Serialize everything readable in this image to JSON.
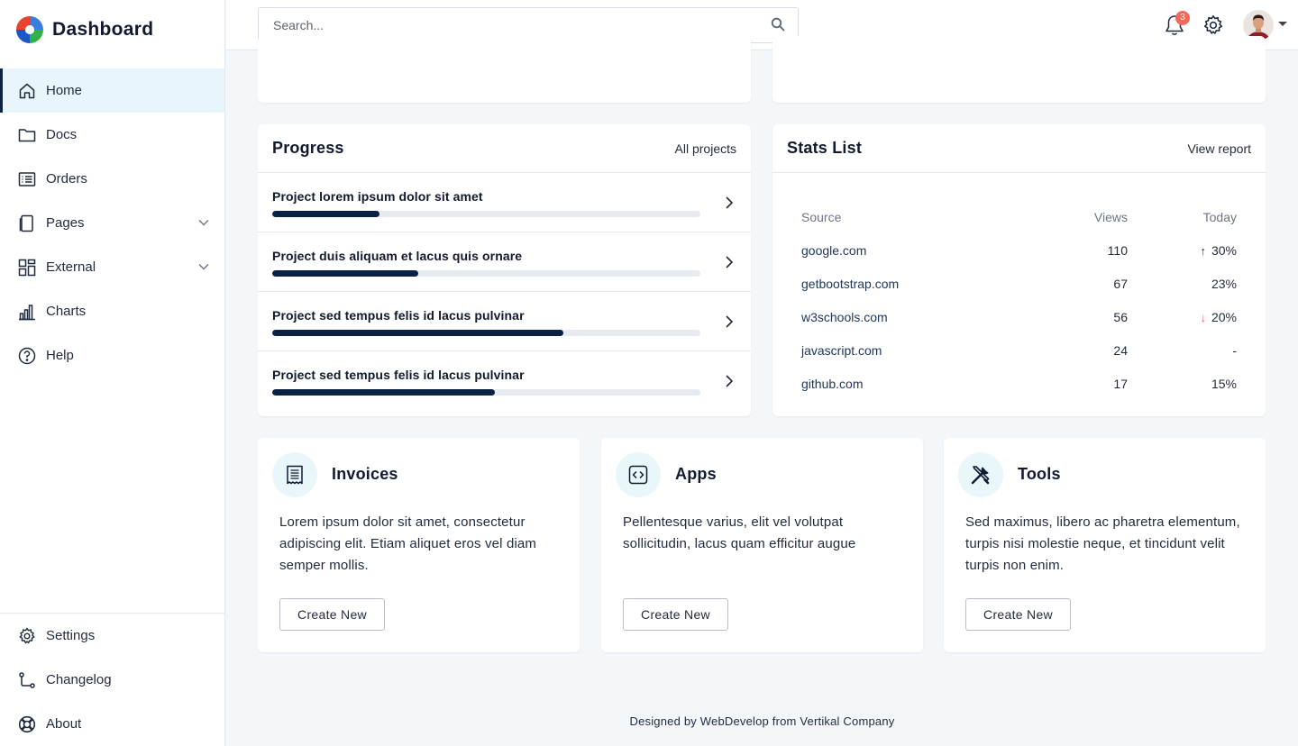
{
  "brand": {
    "title": "Dashboard"
  },
  "sidebar": {
    "items": [
      {
        "label": "Home",
        "icon": "home-icon",
        "active": true
      },
      {
        "label": "Docs",
        "icon": "folder-icon"
      },
      {
        "label": "Orders",
        "icon": "list-icon"
      },
      {
        "label": "Pages",
        "icon": "pages-icon",
        "expandable": true
      },
      {
        "label": "External",
        "icon": "grid-icon",
        "expandable": true
      },
      {
        "label": "Charts",
        "icon": "chart-icon"
      },
      {
        "label": "Help",
        "icon": "help-icon"
      }
    ],
    "bottom_items": [
      {
        "label": "Settings",
        "icon": "gear-icon"
      },
      {
        "label": "Changelog",
        "icon": "changelog-icon"
      },
      {
        "label": "About",
        "icon": "lifebuoy-icon"
      }
    ]
  },
  "topbar": {
    "search_placeholder": "Search...",
    "notification_count": "3",
    "accent": "#f16a5b"
  },
  "progress": {
    "title": "Progress",
    "link": "All projects",
    "projects": [
      {
        "name": "Project lorem ipsum dolor sit amet",
        "percent": 25
      },
      {
        "name": "Project duis aliquam et lacus quis ornare",
        "percent": 34
      },
      {
        "name": "Project sed tempus felis id lacus pulvinar",
        "percent": 68
      },
      {
        "name": "Project sed tempus felis id lacus pulvinar",
        "percent": 52
      }
    ]
  },
  "stats": {
    "title": "Stats List",
    "link": "View report",
    "headers": [
      "Source",
      "Views",
      "Today"
    ],
    "rows": [
      {
        "source": "google.com",
        "views": "110",
        "today": "30%",
        "trend": "up"
      },
      {
        "source": "getbootstrap.com",
        "views": "67",
        "today": "23%",
        "trend": ""
      },
      {
        "source": "w3schools.com",
        "views": "56",
        "today": "20%",
        "trend": "down"
      },
      {
        "source": "javascript.com",
        "views": "24",
        "today": "-",
        "trend": ""
      },
      {
        "source": "github.com",
        "views": "17",
        "today": "15%",
        "trend": ""
      }
    ]
  },
  "features": [
    {
      "title": "Invoices",
      "icon": "invoice-icon",
      "text": "Lorem ipsum dolor sit amet, consectetur adipiscing elit. Etiam aliquet eros vel diam semper mollis.",
      "button": "Create New"
    },
    {
      "title": "Apps",
      "icon": "code-icon",
      "text": "Pellentesque varius, elit vel volutpat sollicitudin, lacus quam efficitur augue",
      "button": "Create New"
    },
    {
      "title": "Tools",
      "icon": "tools-icon",
      "text": "Sed maximus, libero ac pharetra elementum, turpis nisi molestie neque, et tincidunt velit turpis non enim.",
      "button": "Create New"
    }
  ],
  "footer": {
    "text": "Designed by WebDevelop from Vertikal Company"
  }
}
